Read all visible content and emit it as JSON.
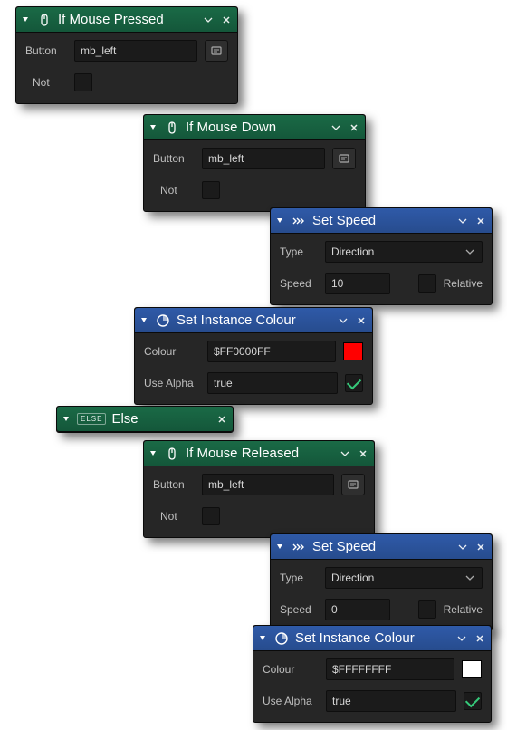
{
  "nodes": {
    "ifPressed": {
      "title": "If Mouse Pressed",
      "button_label": "Button",
      "button_value": "mb_left",
      "not_label": "Not",
      "not_checked": false
    },
    "ifDown": {
      "title": "If Mouse Down",
      "button_label": "Button",
      "button_value": "mb_left",
      "not_label": "Not",
      "not_checked": false
    },
    "setSpeed1": {
      "title": "Set Speed",
      "type_label": "Type",
      "type_value": "Direction",
      "speed_label": "Speed",
      "speed_value": "10",
      "relative_label": "Relative",
      "relative_checked": false
    },
    "setColour1": {
      "title": "Set Instance Colour",
      "colour_label": "Colour",
      "colour_value": "$FF0000FF",
      "colour_swatch": "#ff0000",
      "alpha_label": "Use Alpha",
      "alpha_value": "true",
      "alpha_checked": true
    },
    "elseNode": {
      "tag": "ELSE",
      "title": "Else"
    },
    "ifReleased": {
      "title": "If Mouse Released",
      "button_label": "Button",
      "button_value": "mb_left",
      "not_label": "Not",
      "not_checked": false
    },
    "setSpeed2": {
      "title": "Set Speed",
      "type_label": "Type",
      "type_value": "Direction",
      "speed_label": "Speed",
      "speed_value": "0",
      "relative_label": "Relative",
      "relative_checked": false
    },
    "setColour2": {
      "title": "Set Instance Colour",
      "colour_label": "Colour",
      "colour_value": "$FFFFFFFF",
      "colour_swatch": "#ffffff",
      "alpha_label": "Use Alpha",
      "alpha_value": "true",
      "alpha_checked": true
    }
  }
}
